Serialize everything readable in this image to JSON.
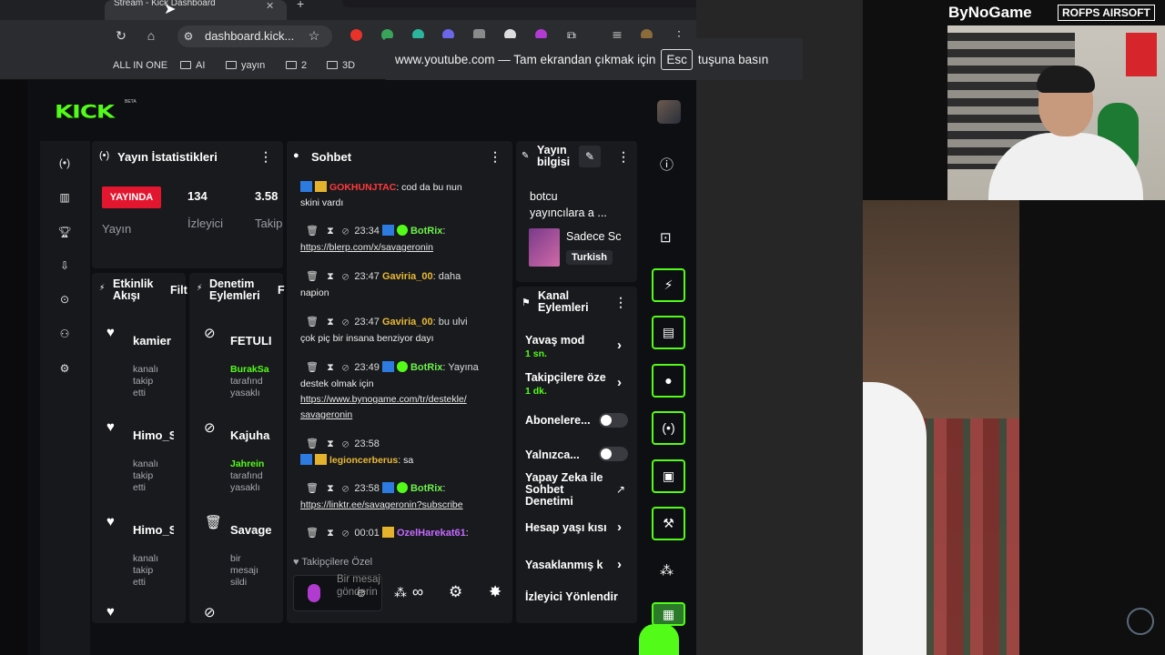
{
  "browser": {
    "tab_title": "Stream - Kick Dashboard",
    "url": "dashboard.kick...",
    "bookmarks": [
      "ALL IN ONE",
      "AI",
      "yayın",
      "2",
      "3D"
    ],
    "fullscreen_toast": {
      "prefix": "www.youtube.com — Tam ekrandan çıkmak için",
      "key": "Esc",
      "suffix": "tuşuna basın"
    }
  },
  "kick": {
    "logo": "KICK",
    "beta": "BETA"
  },
  "stats_panel": {
    "title": "Yayın İstatistikleri",
    "live_badge": "YAYINDA",
    "viewers": "134",
    "followers": "3.58",
    "label_stream": "Yayın",
    "label_viewers": "İzleyici",
    "label_followers": "Takip"
  },
  "activity_panel": {
    "title_line1": "Etkinlik",
    "title_line2": "Akışı",
    "filter": "Filt",
    "items": [
      {
        "name": "kamier",
        "sub1": "kanalı",
        "sub2": "takip",
        "sub3": "etti"
      },
      {
        "name": "Himo_S",
        "sub1": "kanalı",
        "sub2": "takip",
        "sub3": "etti"
      },
      {
        "name": "Himo_S",
        "sub1": "kanalı",
        "sub2": "takip",
        "sub3": "etti"
      }
    ]
  },
  "moderation_panel": {
    "title_line1": "Denetim",
    "title_line2": "Eylemleri",
    "filter": "F",
    "items": [
      {
        "name": "FETULI",
        "actor": "BurakSa",
        "sub1": "tarafınd",
        "sub2": "yasaklı"
      },
      {
        "name": "Kajuha",
        "actor": "Jahrein",
        "sub1": "tarafınd",
        "sub2": "yasaklı"
      },
      {
        "name": "Savage",
        "sub1": "bir",
        "sub2": "mesajı",
        "sub3": "sildi"
      }
    ]
  },
  "chat": {
    "title": "Sohbet",
    "messages": [
      {
        "user": "GOKHUNJTAC",
        "text": ": cod da bu nun",
        "text2": "skini vardı"
      },
      {
        "time": "23:34",
        "user": "BotRix",
        "text": ":",
        "link": "https://blerp.com/x/savageronin"
      },
      {
        "time": "23:47",
        "user": "Gaviria_00",
        "text": ": daha",
        "text2": "napion"
      },
      {
        "time": "23:47",
        "user": "Gaviria_00",
        "text": ": bu ulvi",
        "text2": "çok piç bir insana benziyor dayı"
      },
      {
        "time": "23:49",
        "user": "BotRix",
        "text": ": Yayına",
        "text2": "destek olmak için",
        "link": "https://www.bynogame.com/tr/destekle/",
        "link2": "savageronin"
      },
      {
        "time": "23:58",
        "user": "legioncerberus",
        "text": ": sa"
      },
      {
        "time": "23:58",
        "user": "BotRix",
        "text": ":",
        "link": "https://linktr.ee/savageronin?subscribe"
      },
      {
        "time": "00:01",
        "user": "OzelHarekat61",
        "text": ":"
      }
    ],
    "followers_only": "Takipçilere Özel",
    "input_placeholder": "Bir mesaj gönderin",
    "infinity": "∞"
  },
  "stream_info": {
    "title_line1": "Yayın",
    "title_line2": "bilgisi",
    "desc_line1": "botcu",
    "desc_line2": "yayıncılara a ...",
    "category": "Sadece Sc",
    "language": "Turkish"
  },
  "channel_actions": {
    "title_line1": "Kanal",
    "title_line2": "Eylemleri",
    "slow_mode": "Yavaş mod",
    "slow_mode_value": "1 sn.",
    "followers_only": "Takipçilere öze",
    "followers_only_value": "1 dk.",
    "subscribers_only": "Abonelere...",
    "emotes_only": "Yalnızca...",
    "ai_moderation_l1": "Yapay Zeka ile",
    "ai_moderation_l2": "Sohbet",
    "ai_moderation_l3": "Denetimi",
    "account_age": "Hesap yaşı kısı",
    "banned_words": "Yasaklanmış k",
    "manage_viewers": "İzleyici Yönlendir"
  },
  "overlay": {
    "brand1": "ByNoGame",
    "brand2": "ROFPS AIRSOFT"
  },
  "colors": {
    "kick_green": "#53fc18",
    "live_red": "#e3162f",
    "panel_bg": "#191a1e"
  }
}
